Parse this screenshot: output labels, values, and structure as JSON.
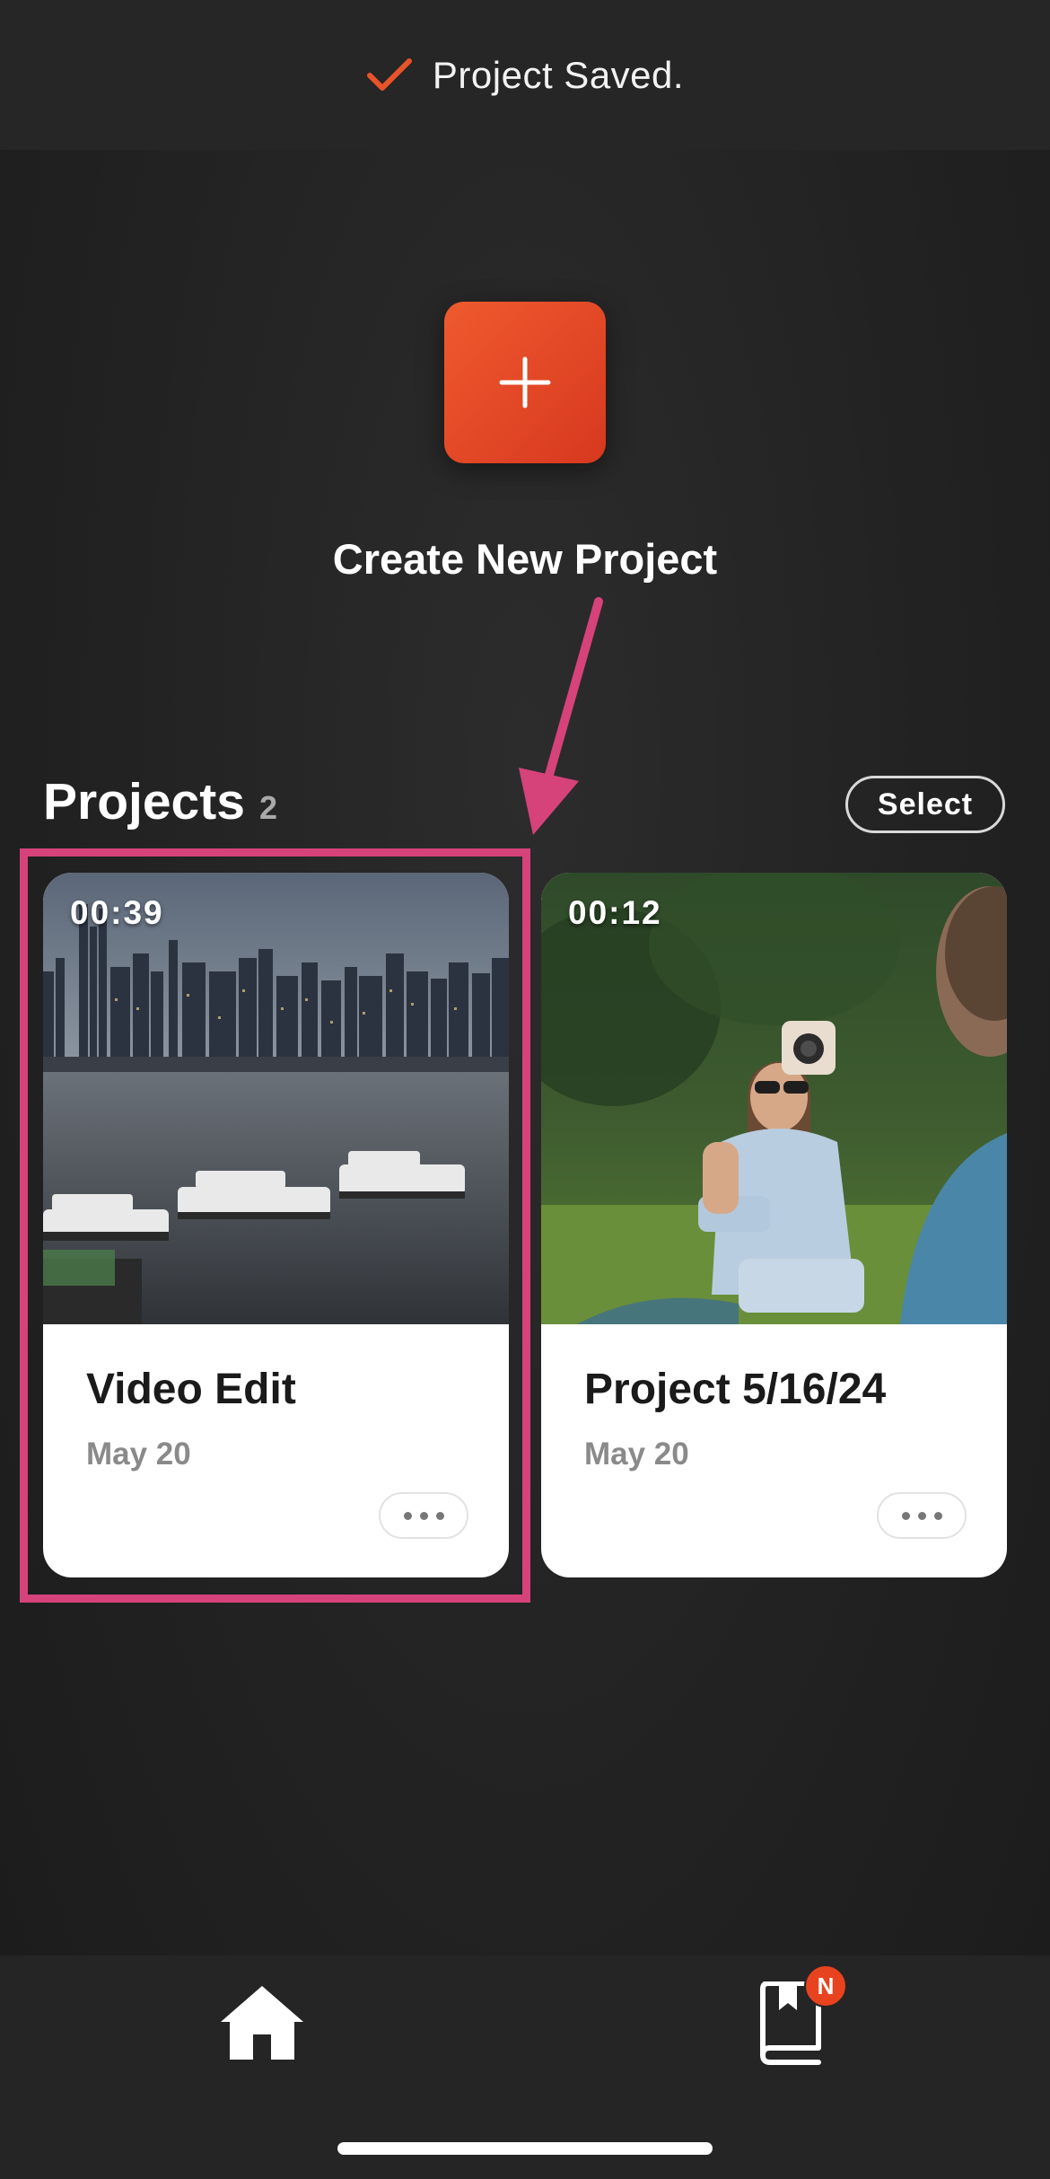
{
  "toast": {
    "message": "Project Saved."
  },
  "create": {
    "label": "Create New Project"
  },
  "projects": {
    "title": "Projects",
    "count": "2",
    "select_label": "Select",
    "items": [
      {
        "duration": "00:39",
        "title": "Video Edit",
        "date": "May 20"
      },
      {
        "duration": "00:12",
        "title": "Project 5/16/24",
        "date": "May 20"
      }
    ]
  },
  "tabbar": {
    "library_badge": "N"
  },
  "colors": {
    "accent": "#e8431f",
    "highlight": "#d6427a",
    "background": "#222222"
  }
}
